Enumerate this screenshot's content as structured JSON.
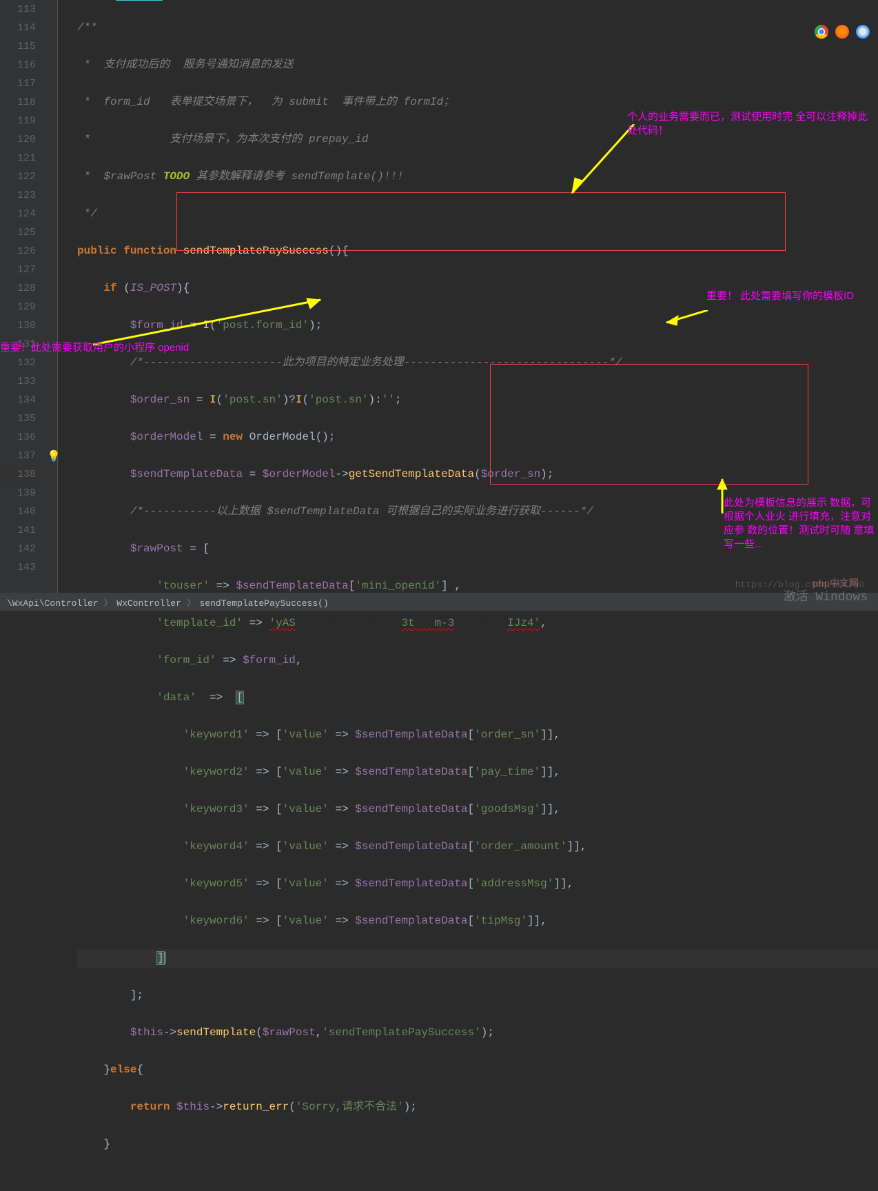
{
  "lines": {
    "start": 113,
    "end": 143
  },
  "code": {
    "l113": "/**",
    "l114": " *  支付成功后的  服务号通知消息的发送",
    "l115": " *  form_id   表单提交场景下，  为 submit  事件带上的 formId；",
    "l116": " *            支付场景下，为本次支付的 prepay_id",
    "l117a": " *  $rawPost ",
    "l117b": "TODO",
    "l117c": " 其参数解释请参考 sendTemplate()!!!",
    "l118": " */",
    "kw_public": "public",
    "kw_function": "function",
    "fn_name": "sendTemplatePaySuccess",
    "kw_if": "if",
    "is_post": "IS_POST",
    "var_formid": "$form_id",
    "fn_I": "I",
    "str_postformid": "'post.form_id'",
    "l122c": "/*---------------------此为项目的特定业务处理-------------------------------*/",
    "var_ordersn": "$order_sn",
    "str_postsn": "'post.sn'",
    "var_ordermodel": "$orderModel",
    "kw_new": "new",
    "cls_ordermodel": "OrderModel",
    "var_sendtpl": "$sendTemplateData",
    "fn_getsend": "getSendTemplateData",
    "l126c": "/*-----------以上数据 $sendTemplateData 可根据自己的实际业务进行获取------*/",
    "var_rawpost": "$rawPost",
    "str_touser": "'touser'",
    "str_miniopenid": "'mini_openid'",
    "str_tplid": "'template_id'",
    "str_tplval": "'yAS",
    "str_tplmid": "3t   m-3",
    "str_tplend": "IJz4'",
    "str_formid": "'form_id'",
    "str_data": "'data'",
    "kw_keyword": "'keyword",
    "str_value": "'value'",
    "keys": [
      "'order_sn'",
      "'pay_time'",
      "'goodsMsg'",
      "'order_amount'",
      "'addressMsg'",
      "'tipMsg'"
    ],
    "var_this": "$this",
    "fn_sendtpl": "sendTemplate",
    "str_sendtplpay": "'sendTemplatePaySuccess'",
    "kw_else": "else",
    "kw_return": "return",
    "fn_returnerr": "return_err",
    "str_sorry": "'Sorry,请求不合法'"
  },
  "annotations": {
    "a1": "个人的业务需要而已，测试使用时完\n全可以注释掉此处代码！",
    "a2": "重要！此处需要获取用户的小程序 openid",
    "a3": "重要！\n此处需要填写你的模板ID",
    "a4": "此处为模板信息的展示\n数据，可根据个人业火\n进行填充，注意对应参\n数的位置！测试时可随\n意填写一些..."
  },
  "breadcrumb": {
    "p1": "\\WxApi\\Controller",
    "p2": "WxController",
    "p3": "sendTemplatePaySuccess()"
  },
  "watermark": {
    "url": "https://blog.csdn.net/u0",
    "php": "php中文网",
    "win1": "激活 Windows"
  }
}
